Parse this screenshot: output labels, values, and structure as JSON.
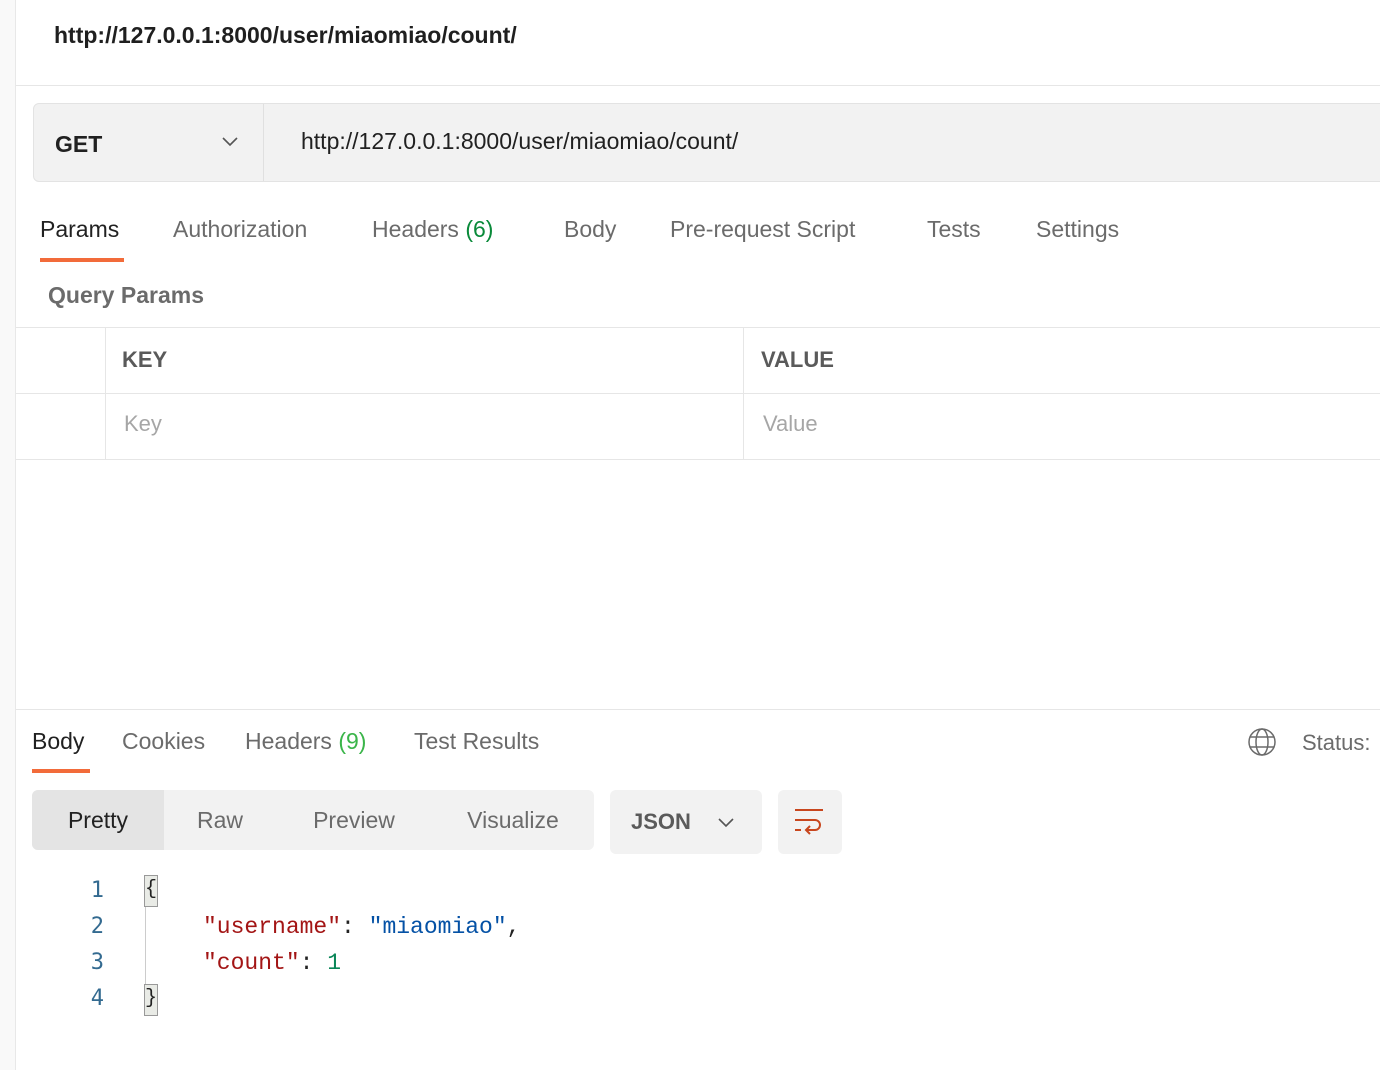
{
  "header": {
    "title": "http://127.0.0.1:8000/user/miaomiao/count/"
  },
  "request": {
    "method": "GET",
    "url": "http://127.0.0.1:8000/user/miaomiao/count/"
  },
  "request_tabs": [
    {
      "label": "Params",
      "active": true
    },
    {
      "label": "Authorization"
    },
    {
      "label": "Headers",
      "count": "(6)"
    },
    {
      "label": "Body"
    },
    {
      "label": "Pre-request Script"
    },
    {
      "label": "Tests"
    },
    {
      "label": "Settings"
    }
  ],
  "query_params": {
    "title": "Query Params",
    "headers": [
      "KEY",
      "VALUE"
    ],
    "placeholders": {
      "key": "Key",
      "value": "Value"
    }
  },
  "response_tabs": [
    {
      "label": "Body",
      "active": true
    },
    {
      "label": "Cookies"
    },
    {
      "label": "Headers",
      "count": "(9)"
    },
    {
      "label": "Test Results"
    }
  ],
  "status_label": "Status:",
  "view_modes": [
    "Pretty",
    "Raw",
    "Preview",
    "Visualize"
  ],
  "format": "JSON",
  "code": {
    "line_numbers": [
      "1",
      "2",
      "3",
      "4"
    ],
    "open": "{",
    "close": "}",
    "key1": "\"username\"",
    "val1": "\"miaomiao\"",
    "key2": "\"count\"",
    "val2": "1"
  },
  "colors": {
    "accent": "#f26b3a",
    "count": "#0a8a3a"
  },
  "icons": [
    "chevron-down-icon",
    "globe-icon",
    "wrap-lines-icon"
  ]
}
